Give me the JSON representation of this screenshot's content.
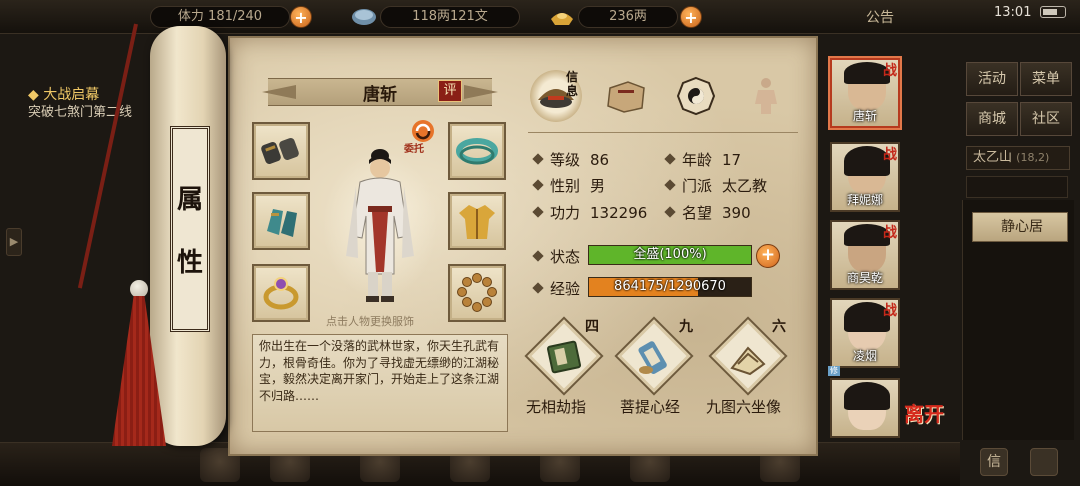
{
  "topbar": {
    "stamina": "体力 181/240",
    "copper": "118两121文",
    "silver": "236两",
    "notice": "公告",
    "time": "13:01"
  },
  "quest": {
    "title": "大战启幕",
    "desc": "突破七煞门第二线"
  },
  "right_menu": {
    "activity": "活动",
    "menu": "菜单",
    "shop": "商城",
    "community": "社区",
    "location": "太乙山",
    "coords": "(18,2)",
    "place": "静心居",
    "mail": "信"
  },
  "scroll": {
    "title_1": "属",
    "title_2": "性"
  },
  "character": {
    "name": "唐斩",
    "rate_label": "评",
    "delegate_label": "委托",
    "outfit_hint": "点击人物更换服饰",
    "bio": "你出生在一个没落的武林世家，你天生孔武有力，根骨奇佳。你为了寻找虚无缥缈的江湖秘宝，毅然决定离开家门，开始走上了这条江湖不归路……"
  },
  "top_icons": {
    "info": "信息"
  },
  "stats": {
    "level_label": "等级",
    "level": "86",
    "age_label": "年龄",
    "age": "17",
    "gender_label": "性别",
    "gender": "男",
    "sect_label": "门派",
    "sect": "太乙教",
    "power_label": "功力",
    "power": "132296",
    "fame_label": "名望",
    "fame": "390",
    "status_label": "状态",
    "status_text": "全盛(100%)",
    "status_fill": 1.0,
    "exp_label": "经验",
    "exp_text": "864175/1290670",
    "exp_fill": 0.67
  },
  "skills": [
    {
      "level": "四",
      "name": "无相劫指"
    },
    {
      "level": "九",
      "name": "菩提心经"
    },
    {
      "level": "六",
      "name": "九图六坐像"
    }
  ],
  "party": [
    {
      "name": "唐斩",
      "badge": "战"
    },
    {
      "name": "拜妮娜",
      "badge": "战"
    },
    {
      "name": "商昊乾",
      "badge": "战"
    },
    {
      "name": "凌烟",
      "badge": "战"
    },
    {
      "name": "",
      "badge": ""
    }
  ],
  "xp_tag": "修",
  "leave_button": "离开",
  "colors": {
    "status_bar": "#5fb52a",
    "exp_bar": "#e3821f",
    "accent_red": "#c4281a"
  }
}
